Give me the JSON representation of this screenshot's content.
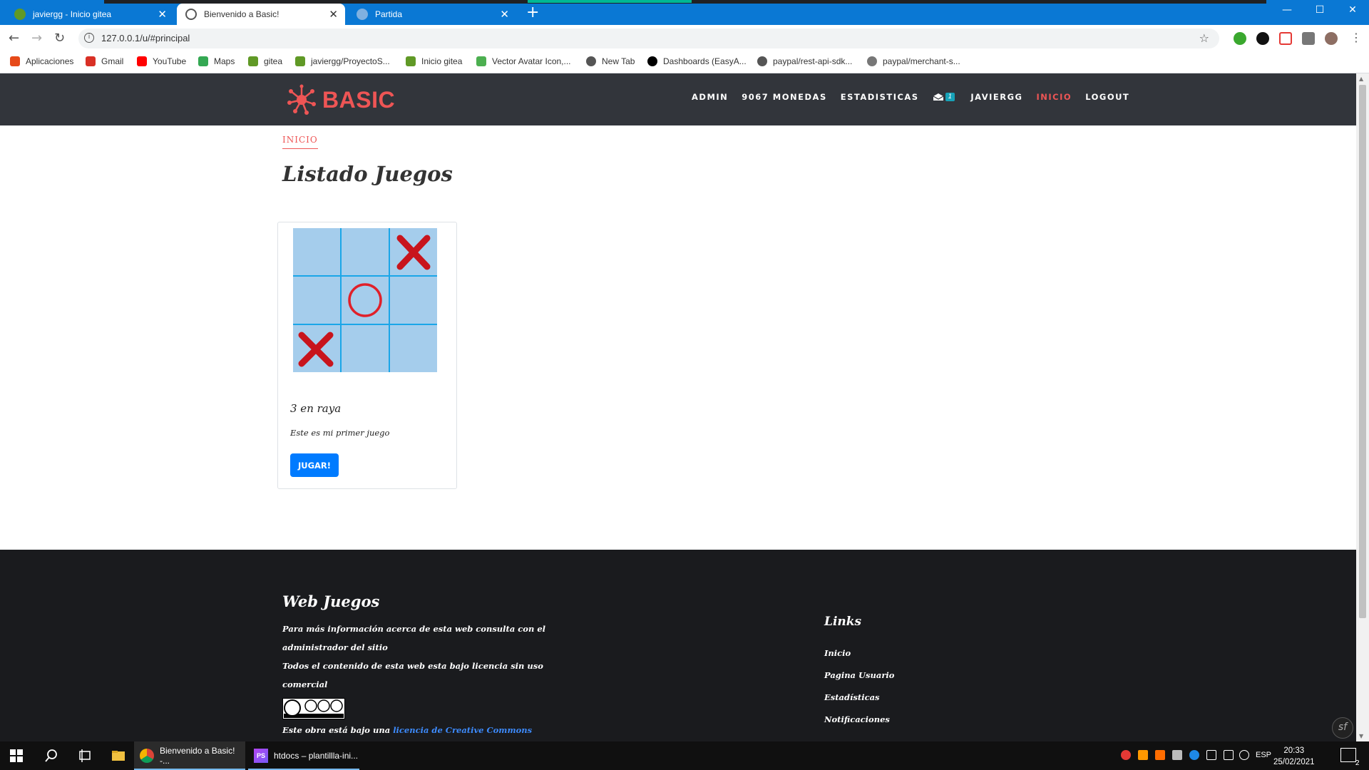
{
  "browser": {
    "tabs": [
      {
        "label": "javiergg - Inicio gitea",
        "active": false
      },
      {
        "label": "Bienvenido a Basic!",
        "active": true
      },
      {
        "label": "Partida",
        "active": false
      }
    ],
    "url": "127.0.0.1/u/#principal",
    "bookmarks": [
      {
        "label": "Aplicaciones",
        "icon": "apps-grid-icon",
        "color": "#e64a19"
      },
      {
        "label": "Gmail",
        "icon": "gmail-icon",
        "color": "#d93025"
      },
      {
        "label": "YouTube",
        "icon": "youtube-icon",
        "color": "#ff0000"
      },
      {
        "label": "Maps",
        "icon": "maps-icon",
        "color": "#34a853"
      },
      {
        "label": "gitea",
        "icon": "gitea-icon",
        "color": "#609926"
      },
      {
        "label": "javiergg/ProyectoS...",
        "icon": "gitea-icon",
        "color": "#609926"
      },
      {
        "label": "Inicio gitea",
        "icon": "gitea-icon",
        "color": "#609926"
      },
      {
        "label": "Vector Avatar Icon,...",
        "icon": "vector-icon",
        "color": "#4caf50"
      },
      {
        "label": "New Tab",
        "icon": "globe-icon",
        "color": "#555555"
      },
      {
        "label": "Dashboards (EasyA...",
        "icon": "symfony-icon",
        "color": "#000000"
      },
      {
        "label": "paypal/rest-api-sdk...",
        "icon": "globe-icon",
        "color": "#555555"
      },
      {
        "label": "paypal/merchant-s...",
        "icon": "github-icon",
        "color": "#555555"
      }
    ]
  },
  "site": {
    "logo_text": "BASIC",
    "menu": {
      "admin": "ADMIN",
      "coins": "9067 MONEDAS",
      "stats": "ESTADISTICAS",
      "mail_count": "1",
      "user": "JAVIERGG",
      "home": "INICIO",
      "logout": "LOGOUT"
    },
    "breadcrumb": "INICIO",
    "title": "Listado Juegos",
    "game": {
      "title": "3 en raya",
      "description": "Este es mi primer juego",
      "button": "JUGAR!"
    },
    "footer": {
      "title": "Web Juegos",
      "text1": "Para más información acerca de esta web consulta con el",
      "text2": "administrador del sitio",
      "text3": "Todos el contenido de esta web esta bajo licencia sin uso",
      "text4": "comercial",
      "license_prefix": "Este obra está bajo una",
      "license_link": "licencia de Creative Commons",
      "links_title": "Links",
      "links": [
        "Inicio",
        "Pagina Usuario",
        "Estadísticas",
        "Notificaciones"
      ]
    }
  },
  "taskbar": {
    "apps": [
      {
        "label": "Bienvenido a Basic! -..."
      },
      {
        "label": "htdocs – plantillla-ini..."
      }
    ],
    "lang": "ESP",
    "time": "20:33",
    "date": "25/02/2021",
    "notifications": "2"
  },
  "colors": {
    "accent": "#ee5555",
    "header_bg": "#32353b",
    "footer_bg": "#1a1b1e",
    "button": "#007bff",
    "chrome_blue": "#0a78d4"
  }
}
